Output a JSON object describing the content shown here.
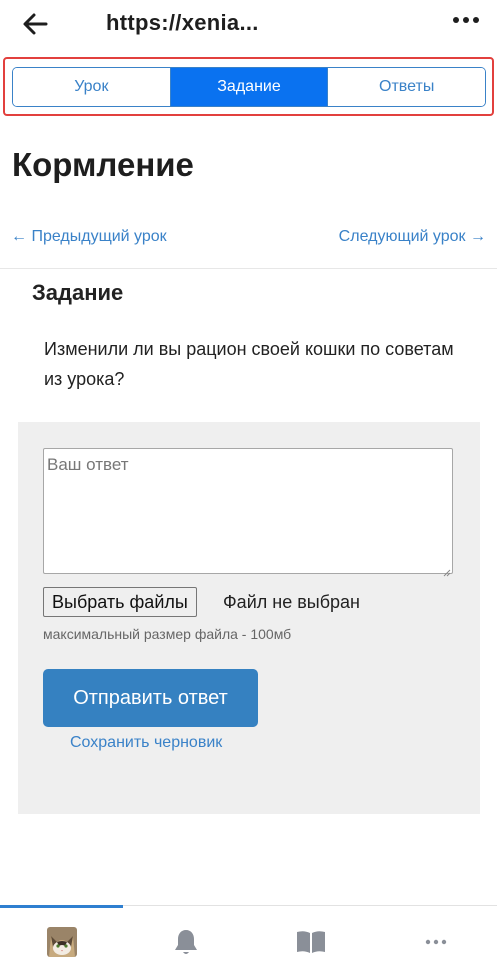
{
  "browser": {
    "url": "https://xenia...",
    "back_icon": "arrow-left-icon",
    "menu_icon": "more-vertical-icon"
  },
  "tabs": [
    {
      "label": "Урок",
      "active": false
    },
    {
      "label": "Задание",
      "active": true
    },
    {
      "label": "Ответы",
      "active": false
    }
  ],
  "colors": {
    "accent": "#3a82c8",
    "active_tab": "#0a72f0",
    "submit": "#3581c1",
    "highlight": "#e2403d"
  },
  "page": {
    "title": "Кормление"
  },
  "lesson_nav": {
    "prev": "← Предыдущий урок",
    "next": "Следующий урок →"
  },
  "task": {
    "title": "Задание",
    "text": "Изменили ли вы рацион своей кошки по советам из урока?"
  },
  "answer_form": {
    "answer_placeholder": "Ваш ответ",
    "file_button": "Выбрать файлы",
    "file_status": "Файл не выбран",
    "file_hint": "максимальный размер файла - 100мб",
    "submit_label": "Отправить ответ",
    "save_draft_label": "Сохранить черновик"
  },
  "bottom_nav": [
    {
      "icon": "cat-avatar",
      "active": true
    },
    {
      "icon": "bell-icon",
      "active": false
    },
    {
      "icon": "book-icon",
      "active": false
    },
    {
      "icon": "more-horizontal-icon",
      "active": false
    }
  ]
}
